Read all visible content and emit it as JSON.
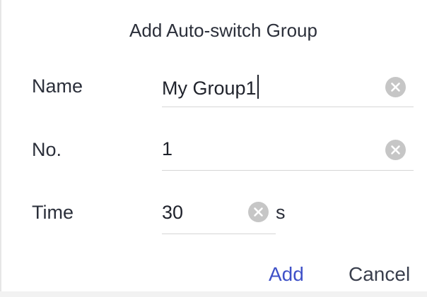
{
  "dialog": {
    "title": "Add Auto-switch Group"
  },
  "fields": {
    "name": {
      "label": "Name",
      "value": "My Group1",
      "clear_icon": "clear-circle-icon"
    },
    "number": {
      "label": "No.",
      "value": "1",
      "clear_icon": "clear-circle-icon"
    },
    "time": {
      "label": "Time",
      "value": "30",
      "unit": "s",
      "clear_icon": "clear-circle-icon"
    }
  },
  "actions": {
    "add_label": "Add",
    "cancel_label": "Cancel"
  },
  "colors": {
    "accent": "#3f51c8",
    "text": "#2b2f3a",
    "divider": "#d6d6d6",
    "clear_icon": "#c6c6c6"
  }
}
